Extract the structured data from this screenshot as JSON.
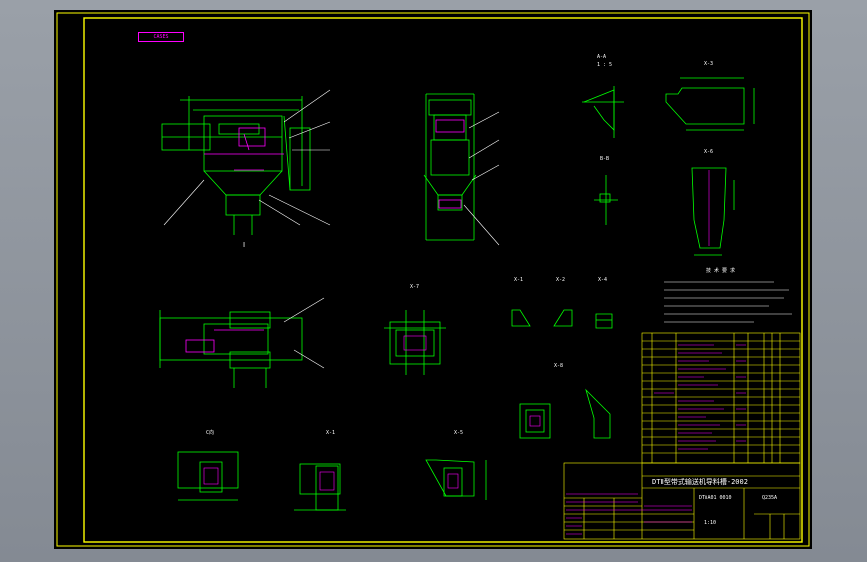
{
  "colors": {
    "frame": "#ffff00",
    "geometry": "#00ff00",
    "dimension": "#ff00ff",
    "text": "#ffffff",
    "accent": "#00ffff",
    "background": "#000000"
  },
  "corner_tag": "CASES",
  "view_labels": {
    "left_front": "Ⅰ",
    "section_a": "A-A",
    "section_b": "B-B",
    "scale_1_5": "1 : 5",
    "detail_1": "X-1",
    "detail_2": "X-2",
    "detail_3": "X-3",
    "detail_4": "X-4",
    "detail_5": "X-5",
    "detail_6": "X-6",
    "detail_7": "X-7",
    "detail_8": "X-8",
    "detail_c": "C向"
  },
  "notes": {
    "heading": "技 术 要 求",
    "lines": [
      "1.",
      "2.",
      "3.",
      "4.",
      "5."
    ]
  },
  "title_block": {
    "title": "DTⅡ型带式输送机导料槽-2002",
    "drawing_no": "DTⅡA01 0010",
    "material": "Q235A",
    "scale": "1:10"
  }
}
